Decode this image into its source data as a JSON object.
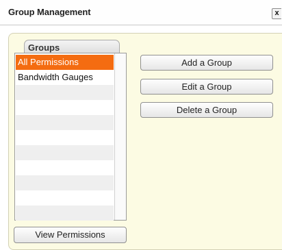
{
  "window": {
    "title": "Group Management",
    "close_label": "x"
  },
  "groups_panel": {
    "tab_label": "Groups",
    "items": [
      {
        "label": "All Permissions",
        "selected": true
      },
      {
        "label": "Bandwidth Gauges",
        "selected": false
      }
    ],
    "view_permissions_label": "View Permissions"
  },
  "actions": {
    "add_label": "Add a Group",
    "edit_label": "Edit a Group",
    "delete_label": "Delete a Group"
  },
  "colors": {
    "selection": "#f46c11",
    "panel_background": "#fcfbe3"
  }
}
